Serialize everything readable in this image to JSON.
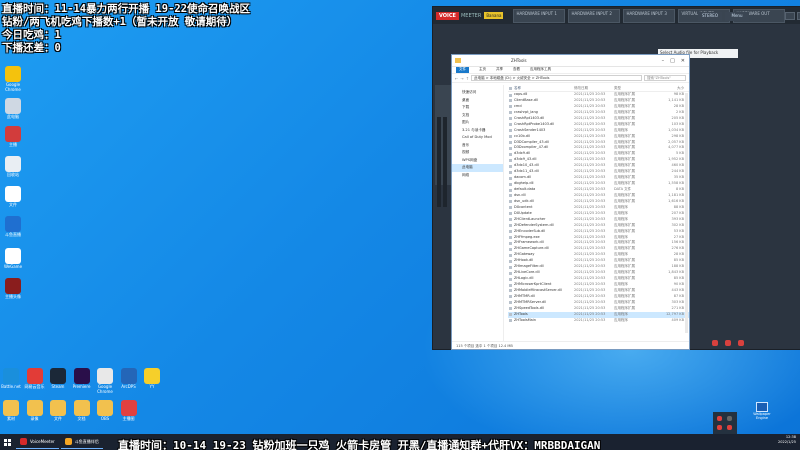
{
  "overlay": {
    "line1": "直播时间：11-14暴力两行开播 19-22使命召唤战区",
    "line2": "钻粉/两飞机吃鸡下播数+1（暂未开放 敬请期待）",
    "line3": "今日吃鸡：1",
    "line4": "下播还差：0"
  },
  "marquee": "直播时间：10-14 19-23 钻粉加班一只鸡 火箭卡房管 开黑/直播通知群+代肝VX：MRBBDAIGAN",
  "voicemeeter": {
    "logo": "VOICE",
    "logo2": "MEETER",
    "logo3": "Banana",
    "inputs": [
      "HARDWARE INPUT 1",
      "HARDWARE INPUT 2",
      "HARDWARE INPUT 3",
      "VIRTUAL INPUTS",
      "HARDWARE OUT"
    ],
    "menu1": "STEREO",
    "menu2": "Menu",
    "note": "Select Audio file for Playback"
  },
  "explorer": {
    "title": "ZHTools",
    "ribbon": [
      "文件",
      "主页",
      "共享",
      "查看",
      "应用程序工具"
    ],
    "path": "此电脑 > 本地磁盘 (D:) > 火绒安全 > ZHTools",
    "search_placeholder": "搜索\"ZHTools\"",
    "columns": [
      "名称",
      "修改日期",
      "类型",
      "大小"
    ],
    "tree": [
      {
        "label": "快速访问",
        "selected": false
      },
      {
        "label": "桌面",
        "selected": false
      },
      {
        "label": "下载",
        "selected": false
      },
      {
        "label": "文档",
        "selected": false
      },
      {
        "label": "图片",
        "selected": false
      },
      {
        "label": "3.21 与读卡器",
        "selected": false
      },
      {
        "label": "Call of Duty Mod",
        "selected": false
      },
      {
        "label": "音乐",
        "selected": false
      },
      {
        "label": "视频",
        "selected": false
      },
      {
        "label": "WPS网盘",
        "selected": false
      },
      {
        "label": "此电脑",
        "selected": true
      },
      {
        "label": "网络",
        "selected": false
      }
    ],
    "files": [
      {
        "name": "caps.dll",
        "date": "2021/11/25 20:53",
        "type": "应用程序扩展",
        "size": "98 KB",
        "selected": false
      },
      {
        "name": "ClientBase.dll",
        "date": "2021/11/25 20:53",
        "type": "应用程序扩展",
        "size": "1,141 KB",
        "selected": false
      },
      {
        "name": "cmd",
        "date": "2021/11/25 20:53",
        "type": "应用程序扩展",
        "size": "28 KB",
        "selected": false
      },
      {
        "name": "crashrpt_lang",
        "date": "2021/11/25 20:53",
        "type": "应用程序扩展",
        "size": "2 KB",
        "selected": false
      },
      {
        "name": "CrashRpt1403.dll",
        "date": "2021/11/25 20:53",
        "type": "应用程序扩展",
        "size": "205 KB",
        "selected": false
      },
      {
        "name": "CrashRptProbe1403.dll",
        "date": "2021/11/25 20:53",
        "type": "应用程序扩展",
        "size": "103 KB",
        "selected": false
      },
      {
        "name": "CrashSender1403",
        "date": "2021/11/25 20:53",
        "type": "应用程序",
        "size": "1,034 KB",
        "selected": false
      },
      {
        "name": "cv10b.dll",
        "date": "2021/11/25 20:53",
        "type": "应用程序扩展",
        "size": "298 KB",
        "selected": false
      },
      {
        "name": "D3DCompiler_43.dll",
        "date": "2021/11/25 20:53",
        "type": "应用程序扩展",
        "size": "2,057 KB",
        "selected": false
      },
      {
        "name": "D3Dcompiler_47.dll",
        "date": "2021/11/25 20:53",
        "type": "应用程序扩展",
        "size": "4,077 KB",
        "selected": false
      },
      {
        "name": "d3dx9.dll",
        "date": "2021/11/25 20:53",
        "type": "应用程序扩展",
        "size": "5 KB",
        "selected": false
      },
      {
        "name": "d3dx9_43.dll",
        "date": "2021/11/25 20:53",
        "type": "应用程序扩展",
        "size": "1,952 KB",
        "selected": false
      },
      {
        "name": "d3dx10_43.dll",
        "date": "2021/11/25 20:53",
        "type": "应用程序扩展",
        "size": "460 KB",
        "selected": false
      },
      {
        "name": "d3dx11_43.dll",
        "date": "2021/11/25 20:53",
        "type": "应用程序扩展",
        "size": "244 KB",
        "selected": false
      },
      {
        "name": "dacom.dll",
        "date": "2021/11/25 20:53",
        "type": "应用程序扩展",
        "size": "35 KB",
        "selected": false
      },
      {
        "name": "dbghelp.dll",
        "date": "2021/11/25 20:53",
        "type": "应用程序扩展",
        "size": "1,558 KB",
        "selected": false
      },
      {
        "name": "default.data",
        "date": "2021/11/25 20:53",
        "type": "DATA 文件",
        "size": "8 KB",
        "selected": false
      },
      {
        "name": "dsn.dll",
        "date": "2021/11/25 20:53",
        "type": "应用程序扩展",
        "size": "1,181 KB",
        "selected": false
      },
      {
        "name": "dsn_udk.dll",
        "date": "2021/11/25 20:53",
        "type": "应用程序扩展",
        "size": "1,616 KB",
        "selected": false
      },
      {
        "name": "DXcontent",
        "date": "2021/11/25 20:53",
        "type": "应用程序",
        "size": "88 KB",
        "selected": false
      },
      {
        "name": "DXUpdate",
        "date": "2021/11/25 20:53",
        "type": "应用程序",
        "size": "207 KB",
        "selected": false
      },
      {
        "name": "ZHClientLauncher",
        "date": "2021/11/25 20:53",
        "type": "应用程序",
        "size": "393 KB",
        "selected": false
      },
      {
        "name": "ZHDefenderSystem.dll",
        "date": "2021/11/25 20:53",
        "type": "应用程序扩展",
        "size": "302 KB",
        "selected": false
      },
      {
        "name": "ZHEncoderSub.dll",
        "date": "2021/11/25 20:53",
        "type": "应用程序扩展",
        "size": "53 KB",
        "selected": false
      },
      {
        "name": "ZHFfmpeg.exe",
        "date": "2021/11/25 20:53",
        "type": "应用程序",
        "size": "27 KB",
        "selected": false
      },
      {
        "name": "ZHFramework.dll",
        "date": "2021/11/25 20:53",
        "type": "应用程序扩展",
        "size": "156 KB",
        "selected": false
      },
      {
        "name": "ZHGameCapture.dll",
        "date": "2021/11/25 20:53",
        "type": "应用程序扩展",
        "size": "276 KB",
        "selected": false
      },
      {
        "name": "ZHGateway",
        "date": "2021/11/25 20:53",
        "type": "应用程序",
        "size": "28 KB",
        "selected": false
      },
      {
        "name": "ZHHook.dll",
        "date": "2021/11/25 20:53",
        "type": "应用程序扩展",
        "size": "85 KB",
        "selected": false
      },
      {
        "name": "ZHImageFilter.dll",
        "date": "2021/11/25 20:53",
        "type": "应用程序扩展",
        "size": "188 KB",
        "selected": false
      },
      {
        "name": "ZHLiveCore.dll",
        "date": "2021/11/25 20:53",
        "type": "应用程序扩展",
        "size": "1,843 KB",
        "selected": false
      },
      {
        "name": "ZHLogic.dll",
        "date": "2021/11/25 20:53",
        "type": "应用程序扩展",
        "size": "85 KB",
        "selected": false
      },
      {
        "name": "ZHMicroserKprtClient",
        "date": "2021/11/25 20:53",
        "type": "应用程序",
        "size": "90 KB",
        "selected": false
      },
      {
        "name": "ZHMobileMiracastServer.dll",
        "date": "2021/11/25 20:53",
        "type": "应用程序扩展",
        "size": "443 KB",
        "selected": false
      },
      {
        "name": "ZHMTMR.dll",
        "date": "2021/11/25 20:53",
        "type": "应用程序扩展",
        "size": "87 KB",
        "selected": false
      },
      {
        "name": "ZHMTMRServer.dll",
        "date": "2021/11/25 20:53",
        "type": "应用程序扩展",
        "size": "303 KB",
        "selected": false
      },
      {
        "name": "ZHSpeedTools.dll",
        "date": "2021/11/25 20:53",
        "type": "应用程序扩展",
        "size": "271 KB",
        "selected": false
      },
      {
        "name": "ZHTools",
        "date": "2021/11/25 20:53",
        "type": "应用程序",
        "size": "12,797 KB",
        "selected": true
      },
      {
        "name": "ZHToolsMain",
        "date": "2021/11/25 20:53",
        "type": "应用程序",
        "size": "409 KB",
        "selected": false
      }
    ],
    "status": "115 个项目   选中 1 个项目 12.4 MB"
  },
  "desktop_icons": [
    {
      "label": "Google Chrome",
      "color": "#f4c20d"
    },
    {
      "label": "此电脑",
      "color": "#cfd8e3"
    },
    {
      "label": "主播",
      "color": "#d23c3c"
    },
    {
      "label": "回收站",
      "color": "#e9eef3"
    },
    {
      "label": "文件",
      "color": "#ffffff"
    },
    {
      "label": "斗鱼直播",
      "color": "#1f6fd0"
    },
    {
      "label": "WeGame",
      "color": "#ffffff"
    },
    {
      "label": "主播头像",
      "color": "#8a1d1d"
    }
  ],
  "app_icons": [
    {
      "label": "Battle.net",
      "color": "#1a8fdc"
    },
    {
      "label": "网易云音乐",
      "color": "#e23c37"
    },
    {
      "label": "Steam",
      "color": "#1b2838"
    },
    {
      "label": "Premiere",
      "color": "#2a0f4a"
    },
    {
      "label": "Google Chrome",
      "color": "#e8e8e8"
    },
    {
      "label": "ArcDPS",
      "color": "#2466b8"
    },
    {
      "label": "YY",
      "color": "#f6cf2a"
    }
  ],
  "folder_icons": [
    {
      "label": "素材",
      "color": "#f2c14e"
    },
    {
      "label": "录像",
      "color": "#f2c14e"
    },
    {
      "label": "文件",
      "color": "#f2c14e"
    },
    {
      "label": "文档",
      "color": "#f2c14e"
    },
    {
      "label": "OBS",
      "color": "#f2c14e"
    },
    {
      "label": "主播图",
      "color": "#e24040"
    }
  ],
  "taskbar": {
    "apps": [
      {
        "label": "VoiceMeeter",
        "color": "#d62a2a"
      },
      {
        "label": "斗鱼直播伴侣",
        "color": "#f5a623"
      }
    ],
    "clock_time": "12:38",
    "clock_date": "2022/1/25",
    "wallpaper_label": "Wallpaper Engine"
  }
}
